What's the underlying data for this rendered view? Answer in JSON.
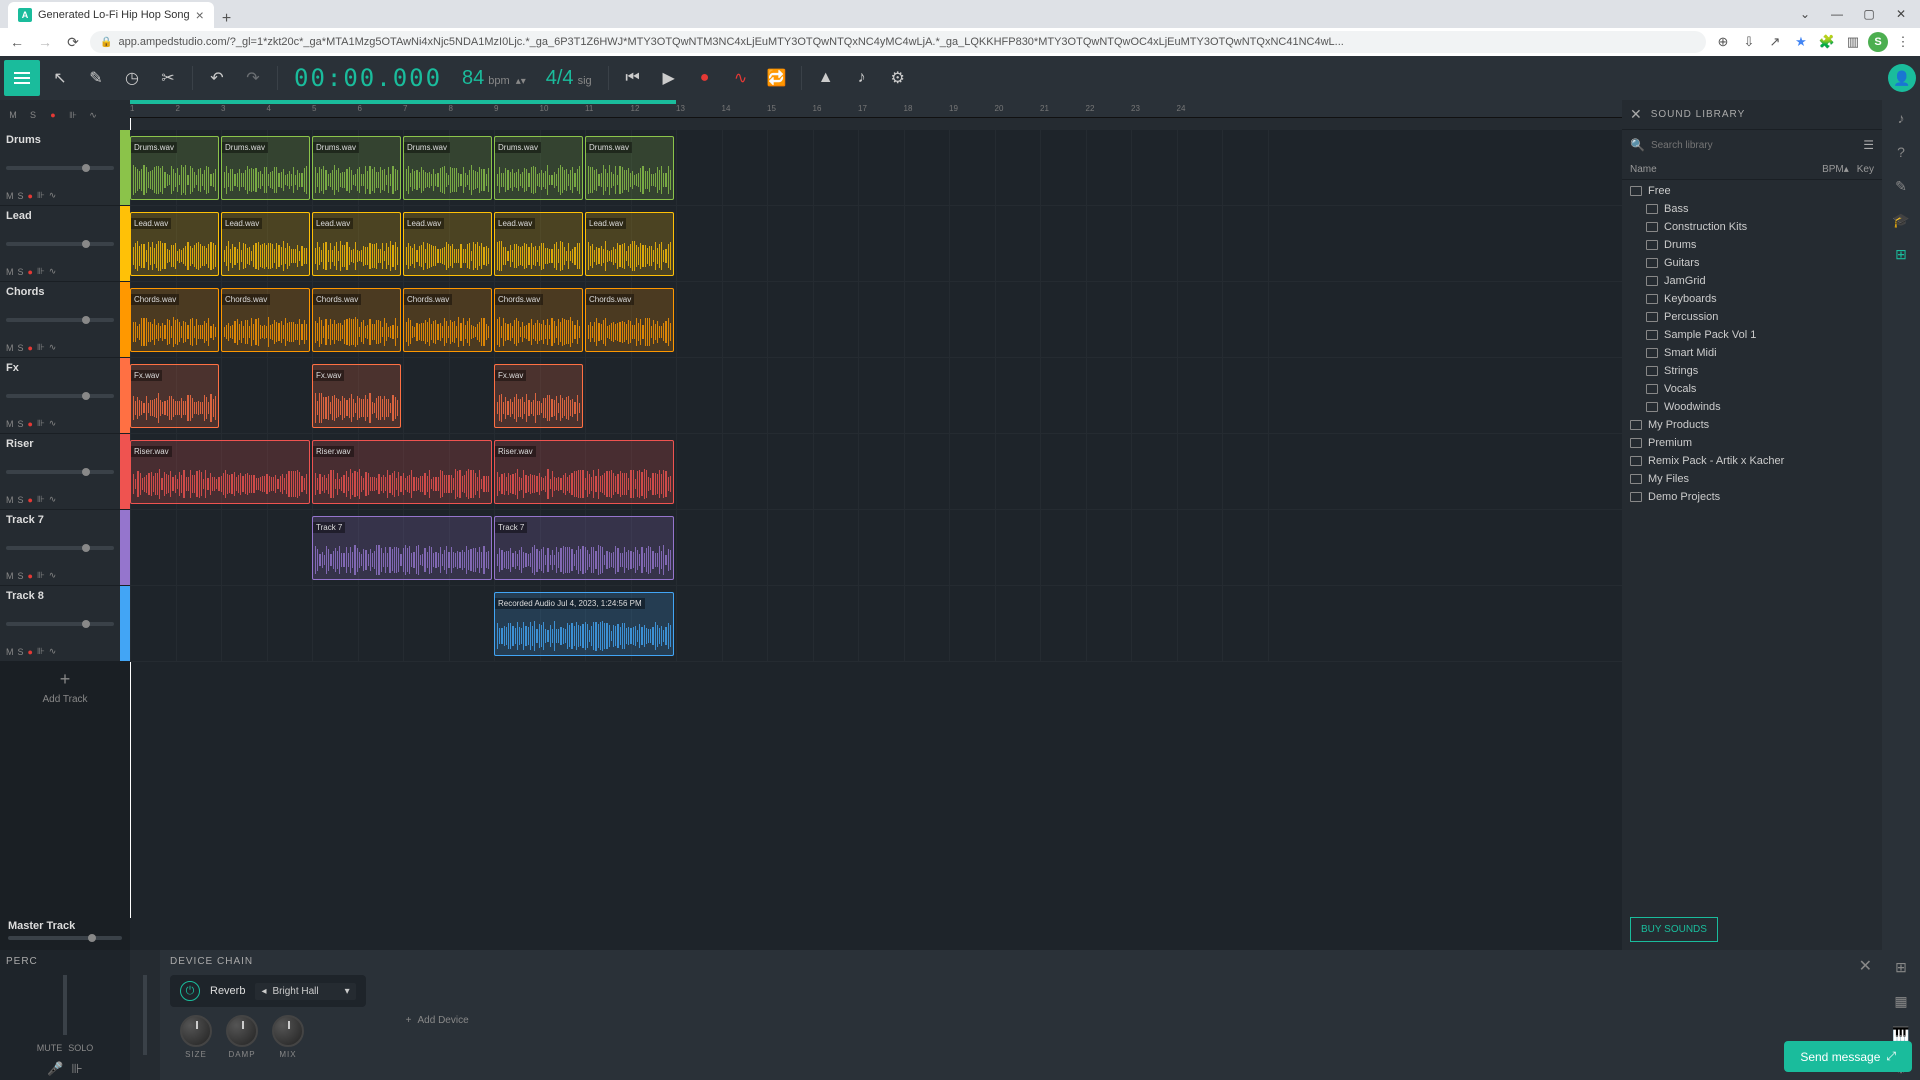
{
  "browser": {
    "tab_title": "Generated Lo-Fi Hip Hop Song",
    "url": "app.ampedstudio.com/?_gl=1*zkt20c*_ga*MTA1Mzg5OTAwNi4xNjc5NDA1MzI0Ljc.*_ga_6P3T1Z6HWJ*MTY3OTQwNTM3NC4xLjEuMTY3OTQwNTQxNC4yMC4wLjA.*_ga_LQKKHFP830*MTY3OTQwNTQwOC4xLjEuMTY3OTQwNTQxNC41NC4wL...",
    "avatar_letter": "S"
  },
  "transport": {
    "time": "00:00.000",
    "bpm": "84",
    "bpm_label": "bpm",
    "sig": "4/4",
    "sig_label": "sig"
  },
  "ruler": {
    "marks": [
      "1",
      "2",
      "3",
      "4",
      "5",
      "6",
      "7",
      "8",
      "9",
      "10",
      "11",
      "12",
      "13",
      "14",
      "15",
      "16",
      "17",
      "18",
      "19",
      "20",
      "21",
      "22",
      "23",
      "24"
    ]
  },
  "tracks": [
    {
      "name": "Drums",
      "color": "#8bc34a",
      "clips": [
        {
          "label": "Drums.wav",
          "start": 0,
          "len": 1
        },
        {
          "label": "Drums.wav",
          "start": 1,
          "len": 1
        },
        {
          "label": "Drums.wav",
          "start": 2,
          "len": 1
        },
        {
          "label": "Drums.wav",
          "start": 3,
          "len": 1
        },
        {
          "label": "Drums.wav",
          "start": 4,
          "len": 1
        },
        {
          "label": "Drums.wav",
          "start": 5,
          "len": 1
        }
      ]
    },
    {
      "name": "Lead",
      "color": "#ffc107",
      "clips": [
        {
          "label": "Lead.wav",
          "start": 0,
          "len": 1
        },
        {
          "label": "Lead.wav",
          "start": 1,
          "len": 1
        },
        {
          "label": "Lead.wav",
          "start": 2,
          "len": 1
        },
        {
          "label": "Lead.wav",
          "start": 3,
          "len": 1
        },
        {
          "label": "Lead.wav",
          "start": 4,
          "len": 1
        },
        {
          "label": "Lead.wav",
          "start": 5,
          "len": 1
        }
      ]
    },
    {
      "name": "Chords",
      "color": "#ff9800",
      "clips": [
        {
          "label": "Chords.wav",
          "start": 0,
          "len": 1
        },
        {
          "label": "Chords.wav",
          "start": 1,
          "len": 1
        },
        {
          "label": "Chords.wav",
          "start": 2,
          "len": 1
        },
        {
          "label": "Chords.wav",
          "start": 3,
          "len": 1
        },
        {
          "label": "Chords.wav",
          "start": 4,
          "len": 1
        },
        {
          "label": "Chords.wav",
          "start": 5,
          "len": 1
        }
      ]
    },
    {
      "name": "Fx",
      "color": "#ff7043",
      "clips": [
        {
          "label": "Fx.wav",
          "start": 0,
          "len": 1
        },
        {
          "label": "Fx.wav",
          "start": 2,
          "len": 1
        },
        {
          "label": "Fx.wav",
          "start": 4,
          "len": 1
        }
      ]
    },
    {
      "name": "Riser",
      "color": "#ef5350",
      "clips": [
        {
          "label": "Riser.wav",
          "start": 0,
          "len": 2
        },
        {
          "label": "Riser.wav",
          "start": 2,
          "len": 2
        },
        {
          "label": "Riser.wav",
          "start": 4,
          "len": 2
        }
      ]
    },
    {
      "name": "Track 7",
      "color": "#9575cd",
      "clips": [
        {
          "label": "Track 7",
          "start": 2,
          "len": 2
        },
        {
          "label": "Track 7",
          "start": 4,
          "len": 2
        }
      ]
    },
    {
      "name": "Track 8",
      "color": "#42a5f5",
      "clips": [
        {
          "label": "Recorded Audio Jul 4, 2023, 1:24:56 PM",
          "start": 4,
          "len": 2
        }
      ]
    }
  ],
  "track_buttons": {
    "m": "M",
    "s": "S"
  },
  "add_track": "Add Track",
  "master_track": "Master Track",
  "library": {
    "title": "SOUND LIBRARY",
    "search_placeholder": "Search library",
    "col_name": "Name",
    "col_bpm": "BPM▴",
    "col_key": "Key",
    "items": [
      {
        "label": "Free",
        "indent": 0
      },
      {
        "label": "Bass",
        "indent": 1
      },
      {
        "label": "Construction Kits",
        "indent": 1
      },
      {
        "label": "Drums",
        "indent": 1
      },
      {
        "label": "Guitars",
        "indent": 1
      },
      {
        "label": "JamGrid",
        "indent": 1
      },
      {
        "label": "Keyboards",
        "indent": 1
      },
      {
        "label": "Percussion",
        "indent": 1
      },
      {
        "label": "Sample Pack Vol 1",
        "indent": 1
      },
      {
        "label": "Smart Midi",
        "indent": 1
      },
      {
        "label": "Strings",
        "indent": 1
      },
      {
        "label": "Vocals",
        "indent": 1
      },
      {
        "label": "Woodwinds",
        "indent": 1
      },
      {
        "label": "My Products",
        "indent": 0
      },
      {
        "label": "Premium",
        "indent": 0
      },
      {
        "label": "Remix Pack - Artik x Kacher",
        "indent": 0
      },
      {
        "label": "My Files",
        "indent": 0
      },
      {
        "label": "Demo Projects",
        "indent": 0
      }
    ],
    "buy": "BUY SOUNDS"
  },
  "bottom": {
    "perc": "PERC",
    "mute": "MUTE",
    "solo": "SOLO",
    "device_chain": "DEVICE CHAIN",
    "device_name": "Reverb",
    "preset": "Bright Hall",
    "knobs": [
      "SIZE",
      "DAMP",
      "MIX"
    ],
    "add_device": "Add Device"
  },
  "send_message": "Send message"
}
